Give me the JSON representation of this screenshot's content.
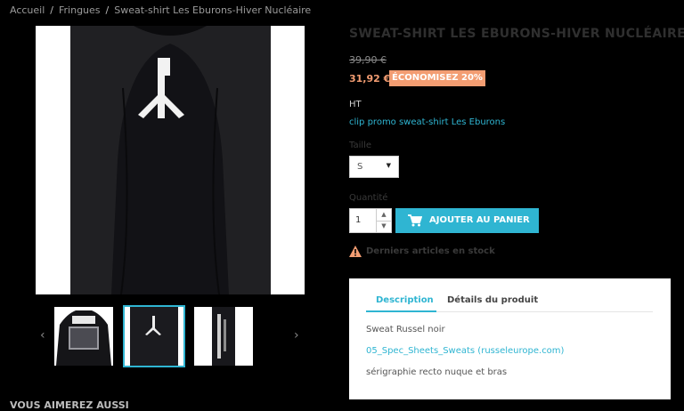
{
  "breadcrumb": {
    "items": [
      "Accueil",
      "Fringues",
      "Sweat-shirt Les Eburons-Hiver Nucléaire"
    ],
    "separator": "/"
  },
  "gallery": {
    "prev_arrow": "‹",
    "next_arrow": "›",
    "thumbnails": [
      "thumbnail-front",
      "thumbnail-back",
      "thumbnail-sleeve"
    ],
    "selected_index": 1
  },
  "product": {
    "title": "SWEAT-SHIRT LES EBURONS-HIVER NUCLÉAIRE",
    "old_price": "39,90 €",
    "price": "31,92 €",
    "discount": "ÉCONOMISEZ 20%",
    "tax_label": "HT",
    "promo_link": "clip promo sweat-shirt Les Eburons"
  },
  "options": {
    "size_label": "Taille",
    "size_value": "S",
    "quantity_label": "Quantité",
    "quantity_value": "1"
  },
  "cart": {
    "add_label": "AJOUTER AU PANIER"
  },
  "stock": {
    "message": "Derniers articles en stock"
  },
  "tabs": {
    "items": [
      "Description",
      "Détails du produit"
    ],
    "active_index": 0
  },
  "description": {
    "line1": "Sweat Russel noir",
    "link": "05_Spec_Sheets_Sweats (russeleurope.com)",
    "line2": "sérigraphie recto nuque et bras"
  },
  "related": {
    "title": "VOUS AIMEREZ AUSSI"
  },
  "colors": {
    "accent": "#2fb5d2",
    "discount": "#f39d72",
    "background": "#000000"
  }
}
